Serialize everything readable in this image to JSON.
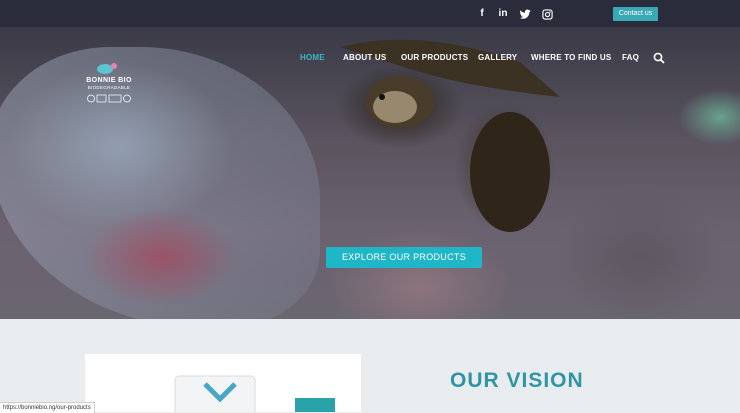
{
  "topbar": {
    "social": [
      {
        "name": "facebook-icon",
        "glyph": "f"
      },
      {
        "name": "linkedin-icon",
        "glyph": "in"
      },
      {
        "name": "twitter-icon",
        "glyph": "t"
      },
      {
        "name": "instagram-icon",
        "glyph": "◎"
      }
    ],
    "contact_label": "Contact us"
  },
  "logo": {
    "line1": "BONNIE BIO",
    "line2": "BIODEGRADABLE",
    "badges": "CE FDA"
  },
  "nav": {
    "items": [
      {
        "label": "HOME",
        "active": true
      },
      {
        "label": "ABOUT US",
        "active": false
      },
      {
        "label": "OUR PRODUCTS",
        "active": false
      },
      {
        "label": "GALLERY",
        "active": false
      },
      {
        "label": "WHERE TO FIND US",
        "active": false
      },
      {
        "label": "FAQ",
        "active": false
      }
    ]
  },
  "hero": {
    "cta_label": "EXPLORE OUR PRODUCTS"
  },
  "vision": {
    "title": "OUR VISION"
  },
  "status": {
    "url": "https://bonniebio.ng/our-products"
  },
  "colors": {
    "accent": "#1fb6c7",
    "topbar": "#2a2c3b",
    "vision_title": "#2f95a5"
  }
}
